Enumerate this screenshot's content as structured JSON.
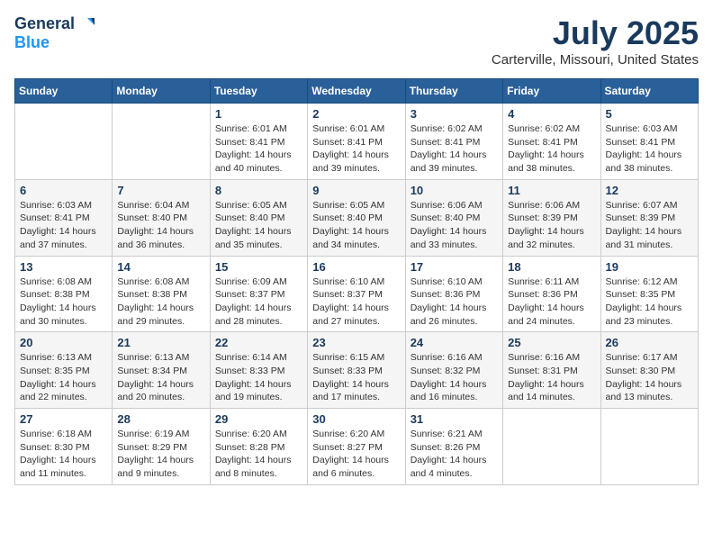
{
  "header": {
    "logo_general": "General",
    "logo_blue": "Blue",
    "month": "July 2025",
    "location": "Carterville, Missouri, United States"
  },
  "weekdays": [
    "Sunday",
    "Monday",
    "Tuesday",
    "Wednesday",
    "Thursday",
    "Friday",
    "Saturday"
  ],
  "weeks": [
    [
      {
        "day": "",
        "info": ""
      },
      {
        "day": "",
        "info": ""
      },
      {
        "day": "1",
        "info": "Sunrise: 6:01 AM\nSunset: 8:41 PM\nDaylight: 14 hours and 40 minutes."
      },
      {
        "day": "2",
        "info": "Sunrise: 6:01 AM\nSunset: 8:41 PM\nDaylight: 14 hours and 39 minutes."
      },
      {
        "day": "3",
        "info": "Sunrise: 6:02 AM\nSunset: 8:41 PM\nDaylight: 14 hours and 39 minutes."
      },
      {
        "day": "4",
        "info": "Sunrise: 6:02 AM\nSunset: 8:41 PM\nDaylight: 14 hours and 38 minutes."
      },
      {
        "day": "5",
        "info": "Sunrise: 6:03 AM\nSunset: 8:41 PM\nDaylight: 14 hours and 38 minutes."
      }
    ],
    [
      {
        "day": "6",
        "info": "Sunrise: 6:03 AM\nSunset: 8:41 PM\nDaylight: 14 hours and 37 minutes."
      },
      {
        "day": "7",
        "info": "Sunrise: 6:04 AM\nSunset: 8:40 PM\nDaylight: 14 hours and 36 minutes."
      },
      {
        "day": "8",
        "info": "Sunrise: 6:05 AM\nSunset: 8:40 PM\nDaylight: 14 hours and 35 minutes."
      },
      {
        "day": "9",
        "info": "Sunrise: 6:05 AM\nSunset: 8:40 PM\nDaylight: 14 hours and 34 minutes."
      },
      {
        "day": "10",
        "info": "Sunrise: 6:06 AM\nSunset: 8:40 PM\nDaylight: 14 hours and 33 minutes."
      },
      {
        "day": "11",
        "info": "Sunrise: 6:06 AM\nSunset: 8:39 PM\nDaylight: 14 hours and 32 minutes."
      },
      {
        "day": "12",
        "info": "Sunrise: 6:07 AM\nSunset: 8:39 PM\nDaylight: 14 hours and 31 minutes."
      }
    ],
    [
      {
        "day": "13",
        "info": "Sunrise: 6:08 AM\nSunset: 8:38 PM\nDaylight: 14 hours and 30 minutes."
      },
      {
        "day": "14",
        "info": "Sunrise: 6:08 AM\nSunset: 8:38 PM\nDaylight: 14 hours and 29 minutes."
      },
      {
        "day": "15",
        "info": "Sunrise: 6:09 AM\nSunset: 8:37 PM\nDaylight: 14 hours and 28 minutes."
      },
      {
        "day": "16",
        "info": "Sunrise: 6:10 AM\nSunset: 8:37 PM\nDaylight: 14 hours and 27 minutes."
      },
      {
        "day": "17",
        "info": "Sunrise: 6:10 AM\nSunset: 8:36 PM\nDaylight: 14 hours and 26 minutes."
      },
      {
        "day": "18",
        "info": "Sunrise: 6:11 AM\nSunset: 8:36 PM\nDaylight: 14 hours and 24 minutes."
      },
      {
        "day": "19",
        "info": "Sunrise: 6:12 AM\nSunset: 8:35 PM\nDaylight: 14 hours and 23 minutes."
      }
    ],
    [
      {
        "day": "20",
        "info": "Sunrise: 6:13 AM\nSunset: 8:35 PM\nDaylight: 14 hours and 22 minutes."
      },
      {
        "day": "21",
        "info": "Sunrise: 6:13 AM\nSunset: 8:34 PM\nDaylight: 14 hours and 20 minutes."
      },
      {
        "day": "22",
        "info": "Sunrise: 6:14 AM\nSunset: 8:33 PM\nDaylight: 14 hours and 19 minutes."
      },
      {
        "day": "23",
        "info": "Sunrise: 6:15 AM\nSunset: 8:33 PM\nDaylight: 14 hours and 17 minutes."
      },
      {
        "day": "24",
        "info": "Sunrise: 6:16 AM\nSunset: 8:32 PM\nDaylight: 14 hours and 16 minutes."
      },
      {
        "day": "25",
        "info": "Sunrise: 6:16 AM\nSunset: 8:31 PM\nDaylight: 14 hours and 14 minutes."
      },
      {
        "day": "26",
        "info": "Sunrise: 6:17 AM\nSunset: 8:30 PM\nDaylight: 14 hours and 13 minutes."
      }
    ],
    [
      {
        "day": "27",
        "info": "Sunrise: 6:18 AM\nSunset: 8:30 PM\nDaylight: 14 hours and 11 minutes."
      },
      {
        "day": "28",
        "info": "Sunrise: 6:19 AM\nSunset: 8:29 PM\nDaylight: 14 hours and 9 minutes."
      },
      {
        "day": "29",
        "info": "Sunrise: 6:20 AM\nSunset: 8:28 PM\nDaylight: 14 hours and 8 minutes."
      },
      {
        "day": "30",
        "info": "Sunrise: 6:20 AM\nSunset: 8:27 PM\nDaylight: 14 hours and 6 minutes."
      },
      {
        "day": "31",
        "info": "Sunrise: 6:21 AM\nSunset: 8:26 PM\nDaylight: 14 hours and 4 minutes."
      },
      {
        "day": "",
        "info": ""
      },
      {
        "day": "",
        "info": ""
      }
    ]
  ]
}
